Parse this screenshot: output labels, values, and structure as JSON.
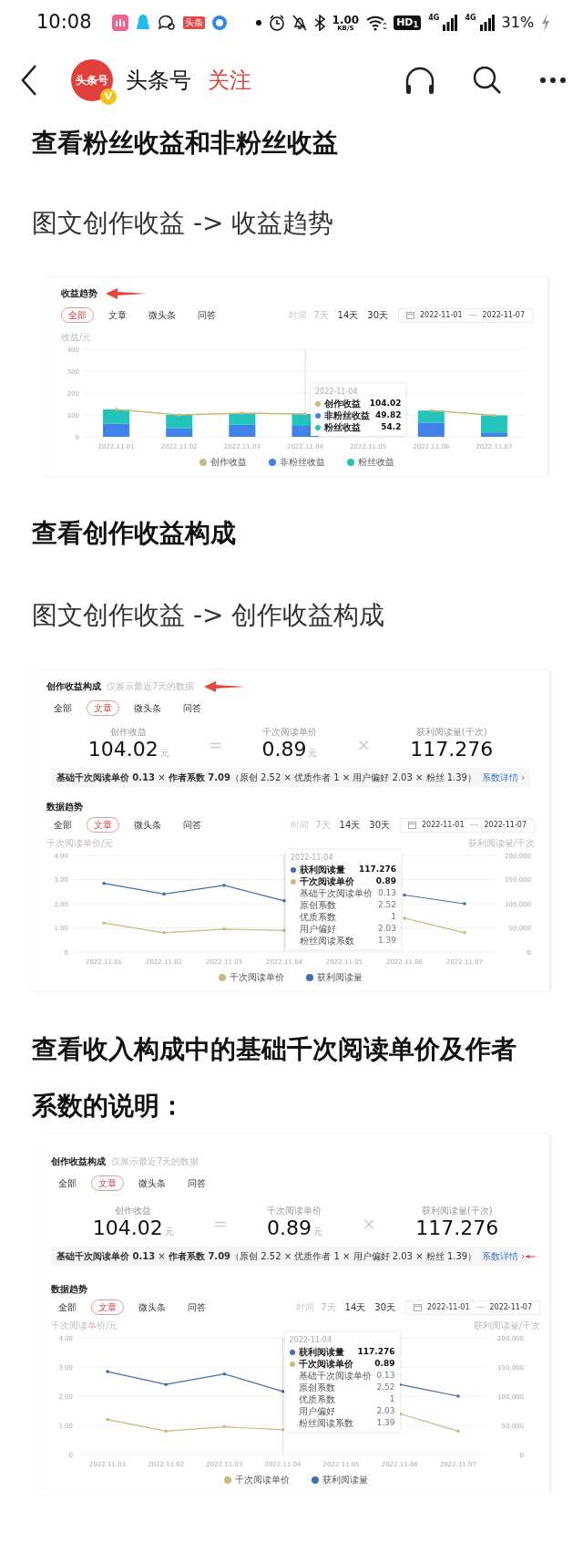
{
  "status_bar": {
    "time": "10:08",
    "app_badge": "头条",
    "net_speed": "1.00",
    "net_speed_unit": "KB/S",
    "hd_label": "HD$_{1}$",
    "signals": [
      {
        "label": "4G"
      },
      {
        "label": "4G"
      }
    ],
    "battery": "31%"
  },
  "header": {
    "avatar_text": "头条号",
    "verified_badge": "V",
    "title": "头条号",
    "follow": "关注"
  },
  "content": [
    {
      "kind": "heading",
      "text": "查看粉丝收益和非粉丝收益"
    },
    {
      "kind": "paragraph",
      "text": "图文创作收益 -> 收益趋势"
    },
    {
      "kind": "revenue_trend",
      "title": "收益趋势",
      "title_arrow": true,
      "tabs": [
        {
          "label": "全部",
          "selected": true
        },
        {
          "label": "文章",
          "selected": false
        },
        {
          "label": "微头条",
          "selected": false
        },
        {
          "label": "问答",
          "selected": false
        }
      ],
      "range_label": "时间",
      "ranges": [
        {
          "label": "7天",
          "selected": true
        },
        {
          "label": "14天",
          "selected": false
        },
        {
          "label": "30天",
          "selected": false
        }
      ],
      "date_from": "2022-11-01",
      "date_to": "2022-11-07",
      "y_axis_label": "收益/元",
      "chart_data": {
        "type": "bar",
        "stacked": true,
        "categories": [
          "2022.11.01",
          "2022.11.02",
          "2022.11.03",
          "2022.11.04",
          "2022.11.05",
          "2022.11.06",
          "2022.11.07"
        ],
        "ylim": [
          0,
          400
        ],
        "yticks": [
          0,
          100,
          200,
          300,
          400
        ],
        "grid": true,
        "legend": true,
        "ref_lines": [
          {
            "axis": "x",
            "value": "2022.11.04",
            "color": "#dddddd"
          }
        ],
        "series": [
          {
            "name": "创作收益",
            "color": "#c9b97a",
            "type": "line",
            "values": [
              125,
              100,
              108,
              104,
              null,
              120,
              98
            ]
          },
          {
            "name": "非粉丝收益",
            "color": "#3f82ea",
            "type": "bar",
            "values": [
              60,
              40,
              55,
              50,
              null,
              65,
              20
            ]
          },
          {
            "name": "粉丝收益",
            "color": "#22c4bb",
            "type": "bar",
            "values": [
              65,
              60,
              53,
              54,
              null,
              55,
              78
            ]
          }
        ]
      },
      "tooltip": {
        "date": "2022-11-04",
        "rows": [
          {
            "kind": "series",
            "label": "创作收益",
            "value": "104.02",
            "color": "#c9b97a"
          },
          {
            "kind": "series",
            "label": "非粉丝收益",
            "value": "49.82",
            "color": "#3f82ea"
          },
          {
            "kind": "series",
            "label": "粉丝收益",
            "value": "54.2",
            "color": "#22c4bb"
          }
        ]
      }
    },
    {
      "kind": "heading",
      "text": "查看创作收益构成"
    },
    {
      "kind": "paragraph",
      "text": "图文创作收益 -> 创作收益构成"
    },
    {
      "kind": "revenue_composition",
      "title": "创作收益构成",
      "subtitle": "仅展示最近7天的数据",
      "title_arrow": true,
      "tabs": [
        {
          "label": "全部",
          "selected": false
        },
        {
          "label": "文章",
          "selected": true
        },
        {
          "label": "微头条",
          "selected": false
        },
        {
          "label": "问答",
          "selected": false
        }
      ],
      "metrics": [
        {
          "label": "创作收益",
          "value": "104.02",
          "unit": "元"
        },
        {
          "operator": "=",
          "label": "千次阅读单价",
          "value": "0.89",
          "unit": "元"
        },
        {
          "operator": "×",
          "label": "获利阅读量(千次)",
          "value": "117.276"
        }
      ],
      "formula": "**基础千次阅读单价 0.13** × **作者系数 7.09**（原创 2.52 × 优质作者 1 × 用户偏好 2.03 × 粉丝 1.39）",
      "detail_link": "系数详情 ›",
      "trend": {
        "title": "数据趋势",
        "tabs": [
          {
            "label": "全部",
            "selected": false
          },
          {
            "label": "文章",
            "selected": true
          },
          {
            "label": "微头条",
            "selected": false
          },
          {
            "label": "问答",
            "selected": false
          }
        ],
        "range_label": "时间",
        "ranges": [
          {
            "label": "7天",
            "selected": true
          },
          {
            "label": "14天",
            "selected": false
          },
          {
            "label": "30天",
            "selected": false
          }
        ],
        "date_from": "2022-11-01",
        "date_to": "2022-11-07",
        "left_axis_label": "千次阅读单价/元",
        "right_axis_label": "获利阅读量/千次",
        "chart_data": {
          "type": "line",
          "categories": [
            "2022.11.01",
            "2022.11.02",
            "2022.11.03",
            "2022.11.04",
            "2022.11.05",
            "2022.11.06",
            "2022.11.07"
          ],
          "ylim": [
            0,
            4
          ],
          "yticks": [
            {
              "value": 0,
              "label": "0"
            },
            {
              "value": 1,
              "label": "1.00"
            },
            {
              "value": 2,
              "label": "2.00"
            },
            {
              "value": 3,
              "label": "3.00"
            },
            {
              "value": 4,
              "label": "4.00"
            }
          ],
          "y2lim": [
            0,
            200000
          ],
          "y2ticks": [
            {
              "value": 0,
              "label": "0"
            },
            {
              "value": 50000,
              "label": "50,000"
            },
            {
              "value": 100000,
              "label": "100,000"
            },
            {
              "value": 150000,
              "label": "150,000"
            },
            {
              "value": 200000,
              "label": "200,000"
            }
          ],
          "grid": true,
          "legend": true,
          "ref_lines": [
            {
              "axis": "x",
              "value": "2022.11.04",
              "color": "#dddddd"
            }
          ],
          "series": [
            {
              "name": "千次阅读单价",
              "color": "#c9b97a",
              "values": [
                1.2,
                0.8,
                0.95,
                0.89,
                null,
                1.4,
                0.8
              ]
            },
            {
              "name": "获利阅读量",
              "color": "#3f6fb0",
              "axis": "y2",
              "values": [
                142000,
                120000,
                138000,
                106000,
                null,
                118000,
                100000
              ]
            }
          ]
        },
        "tooltip": {
          "date": "2022-11-04",
          "rows": [
            {
              "kind": "series",
              "label": "获利阅读量",
              "value": "117.276",
              "color": "#3f6fb0"
            },
            {
              "kind": "series",
              "label": "千次阅读单价",
              "value": "0.89",
              "color": "#c9b97a"
            },
            {
              "kind": "factor",
              "label": "基础千次阅读单价",
              "value": "0.13"
            },
            {
              "kind": "factor",
              "label": "原创系数",
              "value": "2.52"
            },
            {
              "kind": "factor",
              "label": "优质系数",
              "value": "1"
            },
            {
              "kind": "factor",
              "label": "用户偏好",
              "value": "2.03"
            },
            {
              "kind": "factor",
              "label": "粉丝阅读系数",
              "value": "1.39"
            }
          ]
        }
      }
    },
    {
      "kind": "heading",
      "text": "查看收入构成中的基础千次阅读单价及作者系数的说明："
    },
    {
      "kind": "revenue_composition",
      "title": "创作收益构成",
      "subtitle": "仅展示最近7天的数据",
      "detail_arrow": true,
      "tabs": [
        {
          "label": "全部",
          "selected": false
        },
        {
          "label": "文章",
          "selected": true
        },
        {
          "label": "微头条",
          "selected": false
        },
        {
          "label": "问答",
          "selected": false
        }
      ],
      "metrics": [
        {
          "label": "创作收益",
          "value": "104.02",
          "unit": "元"
        },
        {
          "operator": "=",
          "label": "千次阅读单价",
          "value": "0.89",
          "unit": "元"
        },
        {
          "operator": "×",
          "label": "获利阅读量(千次)",
          "value": "117.276"
        }
      ],
      "formula": "**基础千次阅读单价 0.13** × **作者系数 7.09**（原创 2.52 × 优质作者 1 × 用户偏好 2.03 × 粉丝 1.39）",
      "detail_link": "系数详情 ›",
      "trend": {
        "title": "数据趋势",
        "tabs": [
          {
            "label": "全部",
            "selected": false
          },
          {
            "label": "文章",
            "selected": true
          },
          {
            "label": "微头条",
            "selected": false
          },
          {
            "label": "问答",
            "selected": false
          }
        ],
        "range_label": "时间",
        "ranges": [
          {
            "label": "7天",
            "selected": true
          },
          {
            "label": "14天",
            "selected": false
          },
          {
            "label": "30天",
            "selected": false
          }
        ],
        "date_from": "2022-11-01",
        "date_to": "2022-11-07",
        "left_axis_label": "千次阅读单价/元",
        "right_axis_label": "获利阅读量/千次",
        "chart_data": {
          "type": "line",
          "categories": [
            "2022.11.01",
            "2022.11.02",
            "2022.11.03",
            "2022.11.04",
            "2022.11.05",
            "2022.11.06",
            "2022.11.07"
          ],
          "ylim": [
            0,
            4
          ],
          "yticks": [
            {
              "value": 0,
              "label": "0"
            },
            {
              "value": 1,
              "label": "1.00"
            },
            {
              "value": 2,
              "label": "2.00"
            },
            {
              "value": 3,
              "label": "3.00"
            },
            {
              "value": 4,
              "label": "4.00"
            }
          ],
          "y2lim": [
            0,
            200000
          ],
          "y2ticks": [
            {
              "value": 0,
              "label": "0"
            },
            {
              "value": 50000,
              "label": "50,000"
            },
            {
              "value": 100000,
              "label": "100,000"
            },
            {
              "value": 150000,
              "label": "150,000"
            },
            {
              "value": 200000,
              "label": "200,000"
            }
          ],
          "grid": true,
          "legend": true,
          "ref_lines": [
            {
              "axis": "x",
              "value": "2022.11.04",
              "color": "#dddddd"
            }
          ],
          "series": [
            {
              "name": "千次阅读单价",
              "color": "#c9b97a",
              "values": [
                1.2,
                0.8,
                0.95,
                0.85,
                null,
                1.4,
                0.8
              ]
            },
            {
              "name": "获利阅读量",
              "color": "#3f6fb0",
              "axis": "y2",
              "values": [
                142000,
                120000,
                138000,
                108000,
                null,
                120000,
                100000
              ]
            }
          ]
        },
        "tooltip": {
          "date": "2022-11-04",
          "rows": [
            {
              "kind": "series",
              "label": "获利阅读量",
              "value": "117.276",
              "color": "#3f6fb0"
            },
            {
              "kind": "series",
              "label": "千次阅读单价",
              "value": "0.89",
              "color": "#c9b97a"
            },
            {
              "kind": "factor",
              "label": "基础千次阅读单价",
              "value": "0.13"
            },
            {
              "kind": "factor",
              "label": "原创系数",
              "value": "2.52"
            },
            {
              "kind": "factor",
              "label": "优质系数",
              "value": "1"
            },
            {
              "kind": "factor",
              "label": "用户偏好",
              "value": "2.03"
            },
            {
              "kind": "factor",
              "label": "粉丝阅读系数",
              "value": "1.39"
            }
          ]
        }
      }
    }
  ]
}
